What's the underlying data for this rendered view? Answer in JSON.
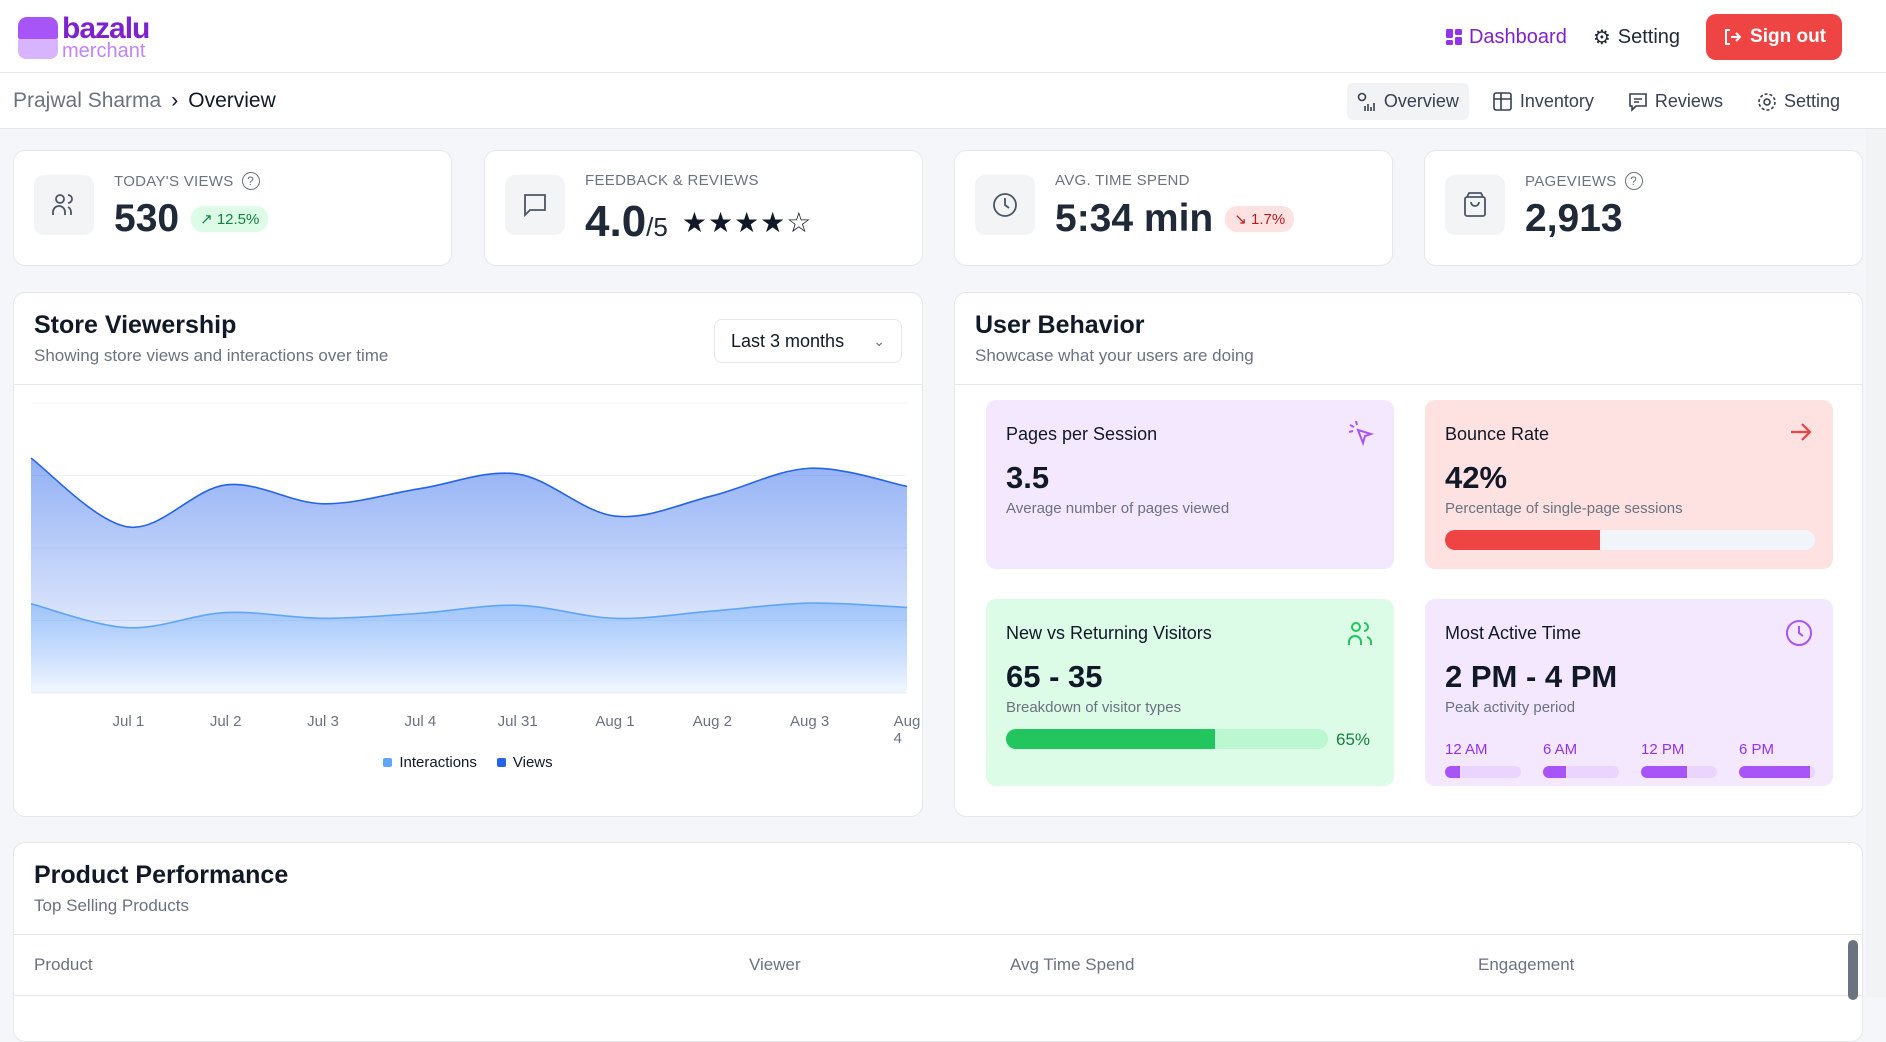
{
  "brand": {
    "name": "bazalu",
    "sub": "merchant"
  },
  "topnav": {
    "dashboard": "Dashboard",
    "setting": "Setting",
    "signout": "Sign out"
  },
  "breadcrumb": {
    "parent": "Prajwal Sharma",
    "current": "Overview"
  },
  "subnav": [
    {
      "label": "Overview",
      "icon": "chart-icon"
    },
    {
      "label": "Inventory",
      "icon": "table-plus-icon"
    },
    {
      "label": "Reviews",
      "icon": "message-icon"
    },
    {
      "label": "Setting",
      "icon": "gear-icon"
    }
  ],
  "stats": [
    {
      "label": "TODAY'S VIEWS",
      "value": "530",
      "badge": "12.5%",
      "trend": "up",
      "help": "?"
    },
    {
      "label": "FEEDBACK & REVIEWS",
      "value": "4.0",
      "suffix": "/5",
      "rating": 4,
      "max": 5
    },
    {
      "label": "AVG. TIME SPEND",
      "value": "5:34 min",
      "badge": "1.7%",
      "trend": "down"
    },
    {
      "label": "PAGEVIEWS",
      "value": "2,913",
      "help": "?"
    }
  ],
  "viewership": {
    "title": "Store Viewership",
    "subtitle": "Showing store views and interactions over time",
    "range": "Last 3 months"
  },
  "chart_data": {
    "type": "area",
    "categories": [
      "",
      "Jul 1",
      "Jul 2",
      "Jul 3",
      "Jul 4",
      "Jul 31",
      "Aug 1",
      "Aug 2",
      "Aug 3",
      "Aug 4"
    ],
    "series": [
      {
        "name": "Interactions",
        "color": "#60a5fa",
        "values": [
          123,
          90,
          111,
          103,
          110,
          121,
          103,
          113,
          124,
          118
        ]
      },
      {
        "name": "Views",
        "color": "#2563eb",
        "values": [
          324,
          229,
          287,
          261,
          282,
          302,
          244,
          272,
          310,
          285
        ]
      }
    ],
    "ylim": [
      0,
      400
    ],
    "grid": true,
    "legend": "bottom"
  },
  "behavior": {
    "title": "User Behavior",
    "subtitle": "Showcase what your users are doing",
    "pages": {
      "title": "Pages per Session",
      "value": "3.5",
      "desc": "Average number of pages viewed"
    },
    "bounce": {
      "title": "Bounce Rate",
      "value": "42%",
      "desc": "Percentage of single-page sessions",
      "fill": 42
    },
    "visitors": {
      "title": "New vs Returning Visitors",
      "value": "65 - 35",
      "desc": "Breakdown of visitor types",
      "fill": 65,
      "pct": "65%"
    },
    "active": {
      "title": "Most Active Time",
      "value": "2 PM - 4 PM",
      "desc": "Peak activity period",
      "slots": [
        {
          "label": "12 AM",
          "fill": 20
        },
        {
          "label": "6 AM",
          "fill": 30
        },
        {
          "label": "12 PM",
          "fill": 60
        },
        {
          "label": "6 PM",
          "fill": 93
        }
      ]
    }
  },
  "products": {
    "title": "Product Performance",
    "subtitle": "Top Selling Products",
    "columns": [
      "Product",
      "Viewer",
      "Avg Time Spend",
      "Engagement"
    ]
  }
}
